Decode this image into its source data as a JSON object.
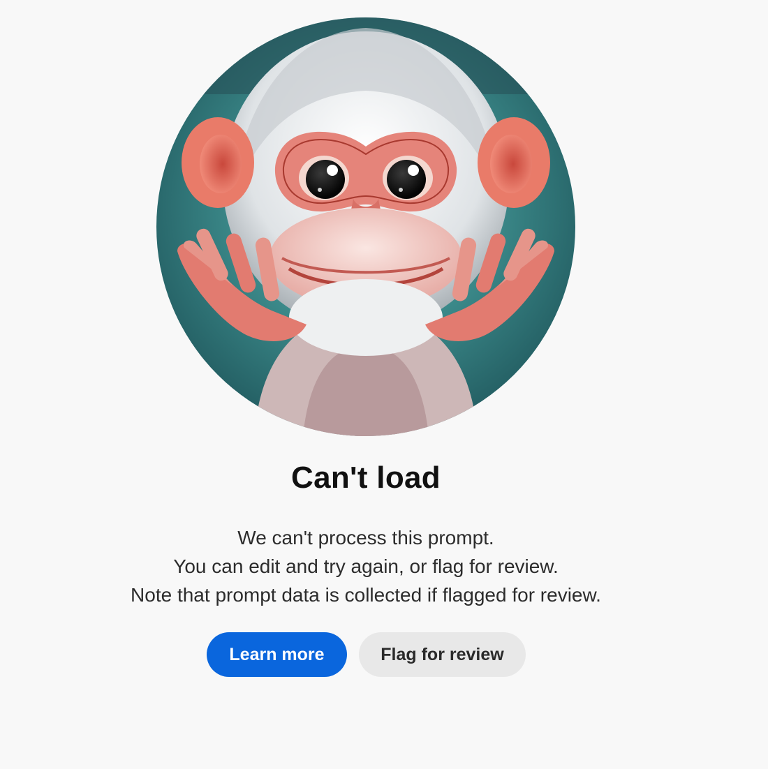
{
  "illustration": {
    "icon": "monkey-illustration",
    "colors": {
      "background": "#2f7f80",
      "fur": "#e9ecee",
      "skin": "#e5847a",
      "muzzle": "#f1c9c4"
    }
  },
  "error": {
    "title": "Can't load",
    "lines": [
      "We can't process this prompt.",
      "You can edit and try again, or flag for review.",
      "Note that prompt data is collected if flagged for review."
    ]
  },
  "actions": {
    "learn_more": "Learn more",
    "flag_for_review": "Flag for review"
  },
  "colors": {
    "primary": "#0a66dd",
    "secondary": "#e8e8e8",
    "page_background": "#f8f8f8"
  }
}
